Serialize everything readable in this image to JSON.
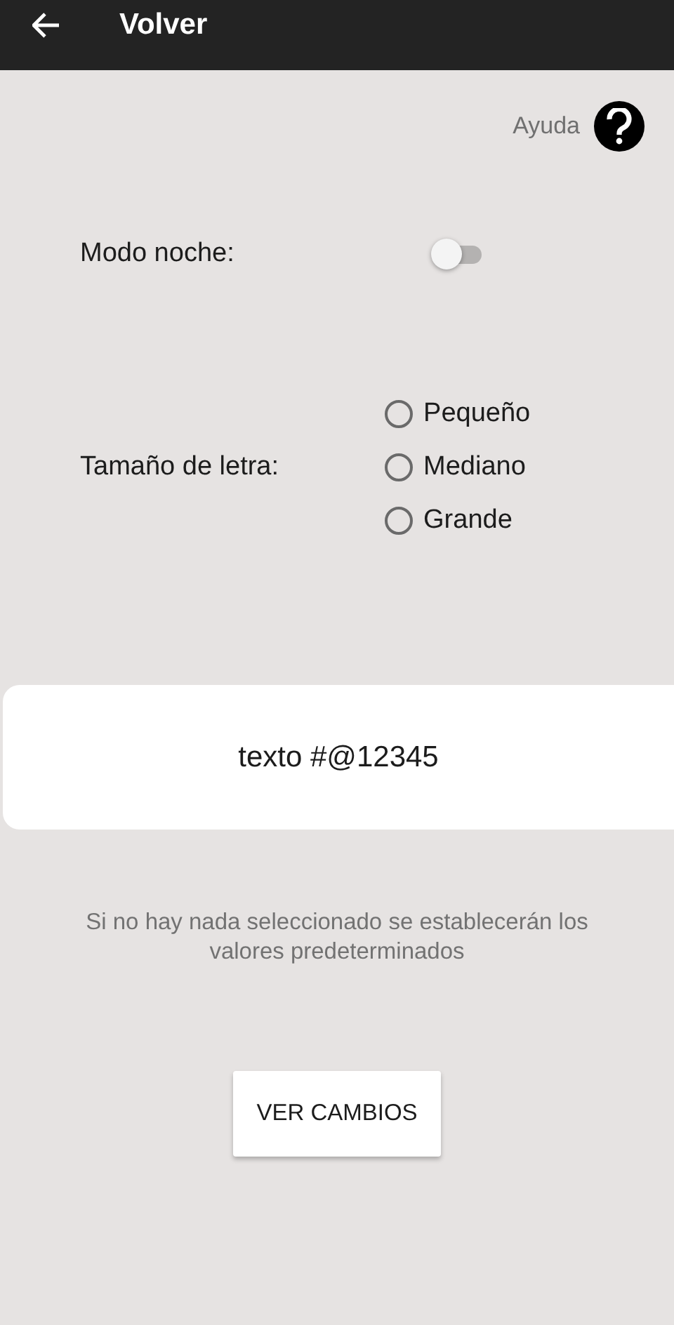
{
  "app_bar": {
    "title": "Volver"
  },
  "help": {
    "label": "Ayuda"
  },
  "night_mode": {
    "label": "Modo noche:",
    "on": false
  },
  "font_size": {
    "label": "Tamaño de letra:",
    "options": [
      {
        "label": "Pequeño",
        "selected": false
      },
      {
        "label": "Mediano",
        "selected": false
      },
      {
        "label": "Grande",
        "selected": false
      }
    ]
  },
  "preview": {
    "text": "texto #@12345"
  },
  "hint": "Si no hay nada seleccionado se establecerán los valores predeterminados",
  "button": "VER CAMBIOS"
}
